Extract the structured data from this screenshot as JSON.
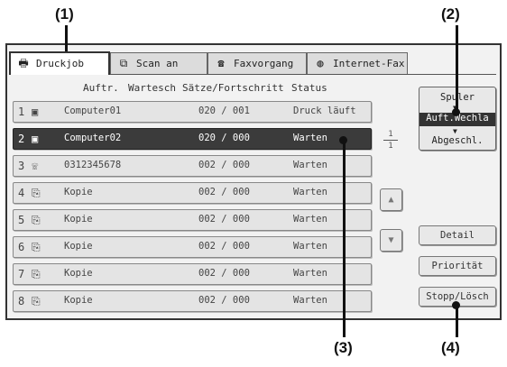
{
  "callouts": [
    "(1)",
    "(2)",
    "(3)",
    "(4)"
  ],
  "tabs": [
    {
      "icon": "printer-icon",
      "glyph": "🖶",
      "label": "Druckjob"
    },
    {
      "icon": "scanner-icon",
      "glyph": "⧉",
      "label": "Scan an"
    },
    {
      "icon": "fax-icon",
      "glyph": "☎",
      "label": "Faxvorgang"
    },
    {
      "icon": "globe-icon",
      "glyph": "◍",
      "label": "Internet-Fax"
    }
  ],
  "columns": {
    "job": "Auftr.",
    "sets": "Wartesch",
    "progress": "Sätze/Fortschritt",
    "status": "Status"
  },
  "jobs": [
    {
      "num": "1",
      "glyph": "▣",
      "name": "Computer01",
      "progress": "020 / 001",
      "status": "Druck läuft"
    },
    {
      "num": "2",
      "glyph": "▣",
      "name": "Computer02",
      "progress": "020 / 000",
      "status": "Warten"
    },
    {
      "num": "3",
      "glyph": "☏",
      "name": "0312345678",
      "progress": "002 / 000",
      "status": "Warten"
    },
    {
      "num": "4",
      "glyph": "⎘",
      "name": "Kopie",
      "progress": "002 / 000",
      "status": "Warten"
    },
    {
      "num": "5",
      "glyph": "⎘",
      "name": "Kopie",
      "progress": "002 / 000",
      "status": "Warten"
    },
    {
      "num": "6",
      "glyph": "⎘",
      "name": "Kopie",
      "progress": "002 / 000",
      "status": "Warten"
    },
    {
      "num": "7",
      "glyph": "⎘",
      "name": "Kopie",
      "progress": "002 / 000",
      "status": "Warten"
    },
    {
      "num": "8",
      "glyph": "⎘",
      "name": "Kopie",
      "progress": "002 / 000",
      "status": "Warten"
    }
  ],
  "mode_select": {
    "options": [
      "Spuler",
      "Auft.Wechla",
      "Abgeschl."
    ],
    "selected": "Auft.Wechla"
  },
  "pager": {
    "current": "1",
    "total": "1"
  },
  "buttons": {
    "detail": "Detail",
    "priority": "Priorität",
    "stop_delete": "Stopp/Lösch"
  },
  "arrows": {
    "up": "▲",
    "down": "▼"
  },
  "colors": {
    "selected_row": "#3b3b3b",
    "panel": "#f2f2f2"
  }
}
